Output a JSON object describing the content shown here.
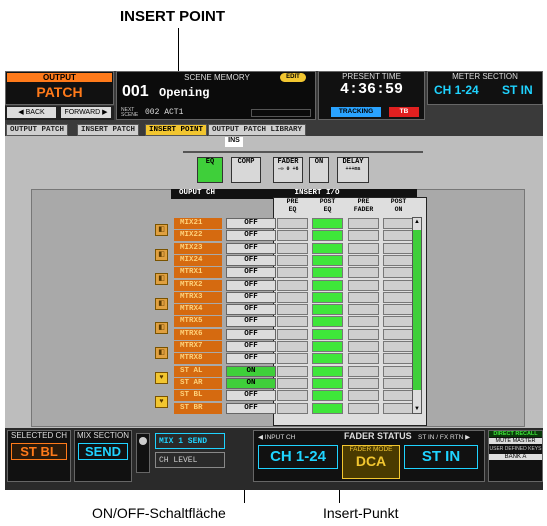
{
  "callouts": {
    "top": "INSERT POINT",
    "bottom_left": "ON/OFF-Schaltfläche",
    "bottom_right": "Insert-Punkt"
  },
  "header": {
    "output_label": "OUTPUT",
    "patch_label": "PATCH",
    "scene_memory_label": "SCENE MEMORY",
    "edit_badge": "EDIT",
    "scene_number": "001",
    "scene_name": "Opening",
    "next_scene_label": "NEXT SCENE",
    "next_scene": "002 ACT1",
    "back_label": "◀ BACK",
    "forward_label": "FORWARD ▶",
    "present_time_label": "PRESENT TIME",
    "present_time": "4:36:59",
    "tracking_label": "TRACKING",
    "tb_label": "TB",
    "meter_section_label": "METER SECTION",
    "meter_ch": "CH 1-24",
    "meter_st": "ST IN"
  },
  "tabs": [
    "OUTPUT PATCH",
    "INSERT PATCH",
    "INSERT POINT",
    "OUTPUT PATCH LIBRARY"
  ],
  "flow": {
    "ins_label": "INS",
    "eq": "EQ",
    "comp": "COMP",
    "fader": "FADER",
    "fader_sub": "-∞ 0 +6",
    "on": "ON",
    "delay": "DELAY",
    "delay_sub": "+++ms"
  },
  "table": {
    "output_ch_header": "OUPUT CH",
    "insert_io_header": "INSERT I/O",
    "col_headers": [
      [
        "PRE",
        "EQ"
      ],
      [
        "POST",
        "EQ"
      ],
      [
        "PRE",
        "FADER"
      ],
      [
        "POST",
        "ON"
      ]
    ],
    "rows": [
      {
        "label": "MIX21",
        "state": "OFF"
      },
      {
        "label": "MIX22",
        "state": "OFF"
      },
      {
        "label": "MIX23",
        "state": "OFF"
      },
      {
        "label": "MIX24",
        "state": "OFF"
      },
      {
        "label": "MTRX1",
        "state": "OFF"
      },
      {
        "label": "MTRX2",
        "state": "OFF"
      },
      {
        "label": "MTRX3",
        "state": "OFF"
      },
      {
        "label": "MTRX4",
        "state": "OFF"
      },
      {
        "label": "MTRX5",
        "state": "OFF"
      },
      {
        "label": "MTRX6",
        "state": "OFF"
      },
      {
        "label": "MTRX7",
        "state": "OFF"
      },
      {
        "label": "MTRX8",
        "state": "OFF"
      },
      {
        "label": "ST AL",
        "state": "ON"
      },
      {
        "label": "ST AR",
        "state": "ON"
      },
      {
        "label": "ST BL",
        "state": "OFF"
      },
      {
        "label": "ST BR",
        "state": "OFF"
      }
    ]
  },
  "footer": {
    "selected_ch_label": "SELECTED CH",
    "selected_ch": "ST BL",
    "mix_section_label": "MIX SECTION",
    "send_label": "SEND",
    "mix1_send": "MIX 1 SEND",
    "ch_level": "CH LEVEL",
    "input_ch_label": "◀ INPUT CH",
    "fader_status_label": "FADER STATUS",
    "st_in_fx_label": "ST IN / FX RTN ▶",
    "ch_group": "CH 1-24",
    "fader_mode_label": "FADER MODE",
    "fader_mode": "DCA",
    "st_in": "ST IN",
    "direct_recall": "DIRECT RECALL",
    "mute_master": "MUTE MASTER",
    "user_defined_keys": "USER DEFINED KEYS",
    "bank": "BANK A"
  }
}
